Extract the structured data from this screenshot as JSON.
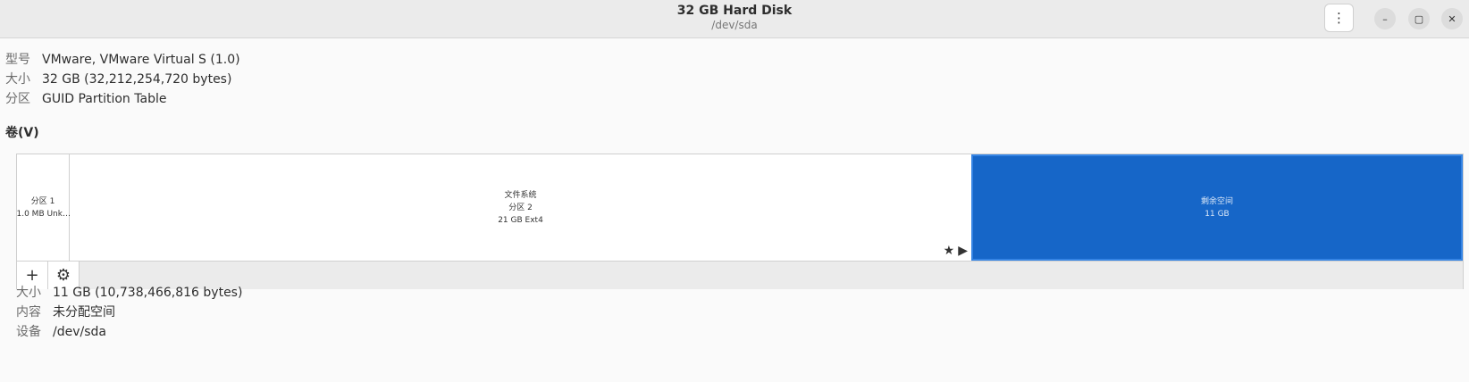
{
  "window": {
    "title": "32 GB Hard Disk",
    "subtitle": "/dev/sda",
    "menu_icon": "⋮",
    "minimize_icon": "–",
    "maximize_icon": "▢",
    "close_icon": "✕"
  },
  "disk_info": [
    {
      "key": "型号",
      "value": "VMware, VMware Virtual S (1.0)"
    },
    {
      "key": "大小",
      "value": "32 GB (32,212,254,720 bytes)"
    },
    {
      "key": "分区",
      "value": "GUID Partition Table"
    }
  ],
  "volumes_label": "卷(V)",
  "segments": [
    {
      "line1": "分区 1",
      "line2": "1.0 MB Unk…",
      "line3": ""
    },
    {
      "line1": "文件系统",
      "line2": "分区 2",
      "line3": "21 GB Ext4",
      "icons": [
        "★",
        "▶"
      ]
    },
    {
      "line1": "剩余空间",
      "line2": "11 GB",
      "line3": ""
    }
  ],
  "toolbar": {
    "add_icon": "+",
    "settings_icon": "⚙"
  },
  "selected_info": [
    {
      "key": "大小",
      "value": "11 GB (10,738,466,816 bytes)"
    },
    {
      "key": "内容",
      "value": "未分配空间"
    },
    {
      "key": "设备",
      "value": "/dev/sda"
    }
  ],
  "colors": {
    "selected_segment": "#1666c8",
    "accent": "#3584e4"
  }
}
